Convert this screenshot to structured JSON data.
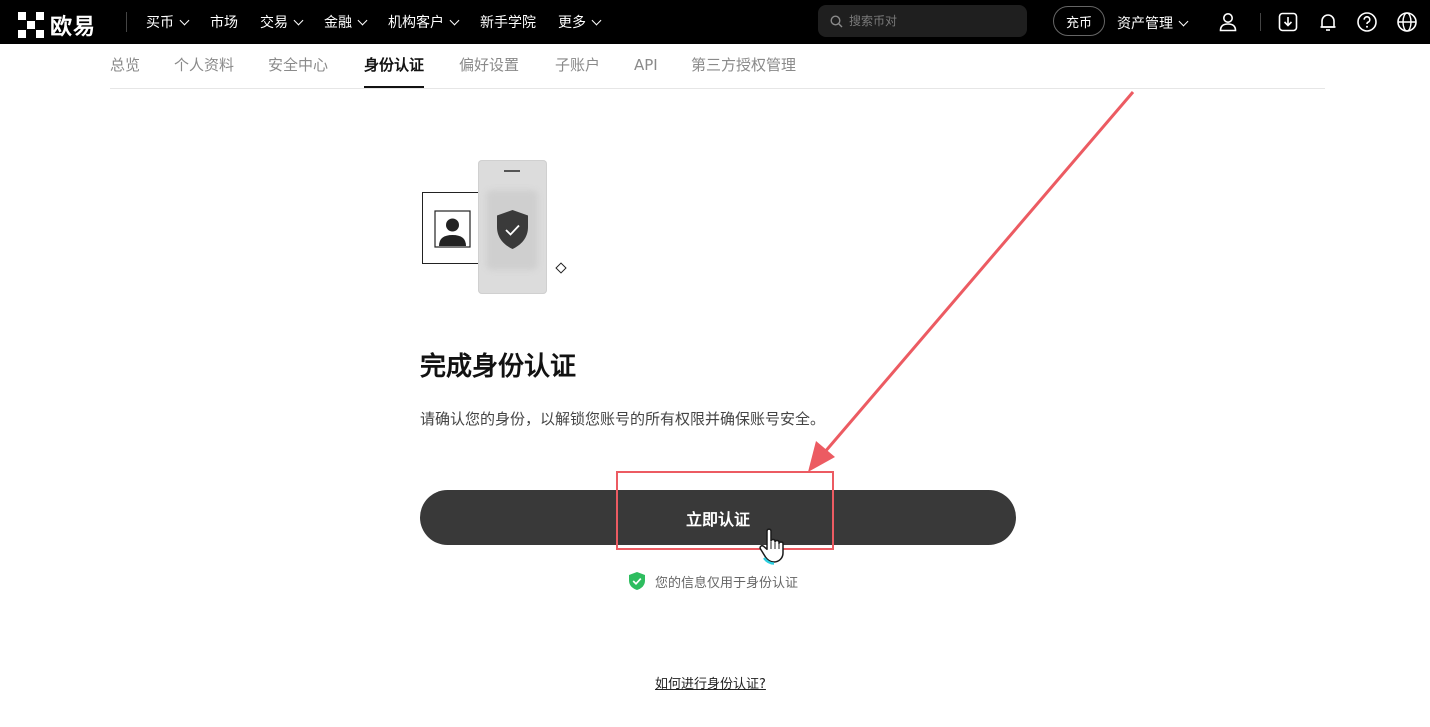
{
  "header": {
    "logo_text": "欧易",
    "nav": [
      {
        "label": "买币",
        "has_menu": true
      },
      {
        "label": "市场",
        "has_menu": false
      },
      {
        "label": "交易",
        "has_menu": true
      },
      {
        "label": "金融",
        "has_menu": true
      },
      {
        "label": "机构客户",
        "has_menu": true
      },
      {
        "label": "新手学院",
        "has_menu": false
      },
      {
        "label": "更多",
        "has_menu": true
      }
    ],
    "search_placeholder": "搜索币对",
    "deposit_label": "充币",
    "assets_label": "资产管理",
    "icons": [
      "user-icon",
      "download-icon",
      "bell-icon",
      "help-icon",
      "globe-icon"
    ]
  },
  "tabs": [
    {
      "label": "总览",
      "active": false
    },
    {
      "label": "个人资料",
      "active": false
    },
    {
      "label": "安全中心",
      "active": false
    },
    {
      "label": "身份认证",
      "active": true
    },
    {
      "label": "偏好设置",
      "active": false
    },
    {
      "label": "子账户",
      "active": false
    },
    {
      "label": "API",
      "active": false
    },
    {
      "label": "第三方授权管理",
      "active": false
    }
  ],
  "main": {
    "title": "完成身份认证",
    "description": "请确认您的身份，以解锁您账号的所有权限并确保账号安全。",
    "cta_label": "立即认证",
    "privacy_note": "您的信息仅用于身份认证",
    "help_link": "如何进行身份认证?"
  },
  "colors": {
    "topbar_bg": "#000000",
    "cta_bg": "#393939",
    "annotation": "#ec5b62",
    "privacy_shield": "#2ebd5f"
  }
}
